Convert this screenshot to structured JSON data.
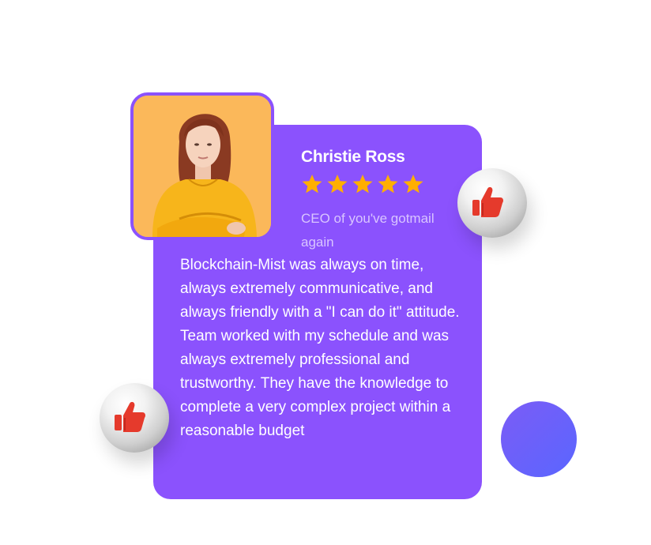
{
  "testimonial": {
    "name": "Christie Ross",
    "rating": 5,
    "rating_max": 5,
    "role": "CEO of you've gotmail again",
    "quote": "Blockchain-Mist was always on time, always extremely communicative, and always friendly with a \"I can do it\" attitude. Team worked with my schedule and was always extremely professional and trustworthy. They have the knowledge to complete a very complex project within a reasonable budget"
  },
  "icons": {
    "star": "star-icon",
    "thumbs_up": "thumbs-up-icon"
  },
  "colors": {
    "card": "#8b52fd",
    "avatar_background": "#fbb85a",
    "star": "#ffaf00",
    "thumb": "#e53a2c",
    "accent_dot": "#5a66ff"
  }
}
